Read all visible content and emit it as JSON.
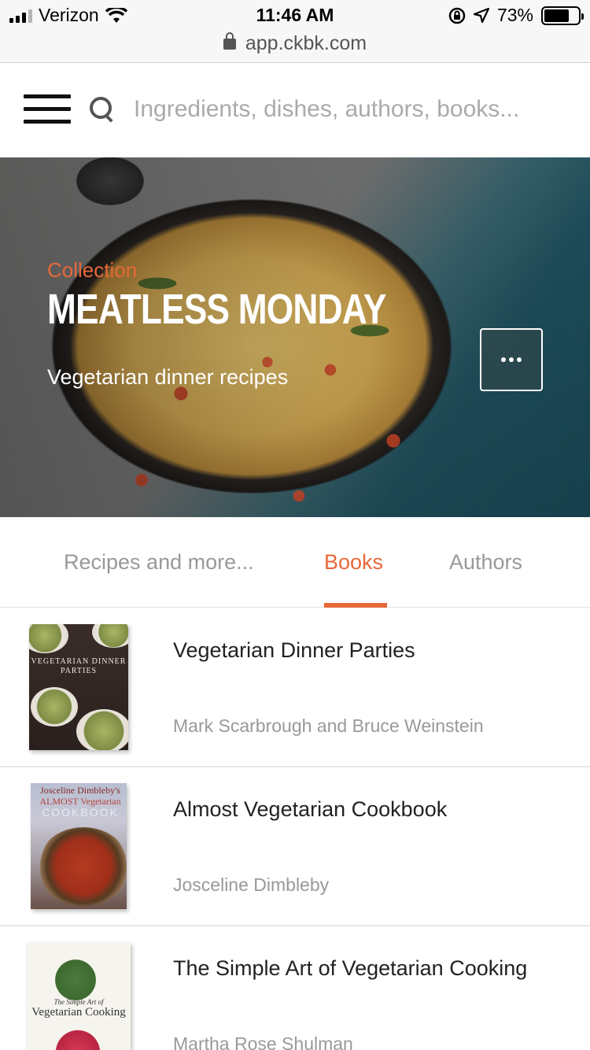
{
  "status_bar": {
    "carrier": "Verizon",
    "time": "11:46 AM",
    "battery_percent": "73%",
    "battery_level": 0.73,
    "icons": [
      "signal-icon",
      "wifi-icon",
      "rotation-lock-icon",
      "location-icon",
      "battery-icon"
    ]
  },
  "url_bar": {
    "url": "app.ckbk.com",
    "icon": "lock-icon"
  },
  "header": {
    "menu_icon": "hamburger-icon",
    "search_icon": "search-icon",
    "search_placeholder": "Ingredients, dishes, authors, books..."
  },
  "hero": {
    "label": "Collection",
    "title": "MEATLESS MONDAY",
    "subtitle": "Vegetarian dinner recipes",
    "more_icon": "ellipsis-icon"
  },
  "tabs": [
    {
      "label": "Recipes and more...",
      "active": false
    },
    {
      "label": "Books",
      "active": true
    },
    {
      "label": "Authors",
      "active": false
    }
  ],
  "books": [
    {
      "title": "Vegetarian Dinner Parties",
      "author": "Mark Scarbrough and Bruce Weinstein",
      "cover_text": "VEGETARIAN DINNER PARTIES"
    },
    {
      "title": "Almost Vegetarian Cookbook",
      "author": "Josceline Dimbleby",
      "cover_text_line1": "Josceline Dimbleby's",
      "cover_text_line2": "ALMOST Vegetarian",
      "cover_text_line3": "COOKBOOK"
    },
    {
      "title": "The Simple Art of Vegetarian Cooking",
      "author": "Martha Rose Shulman",
      "cover_text_line1": "The Simple Art of",
      "cover_text_line2": "Vegetarian Cooking"
    }
  ],
  "colors": {
    "accent": "#e8683a",
    "muted_text": "#999999",
    "title_text": "#222222"
  }
}
